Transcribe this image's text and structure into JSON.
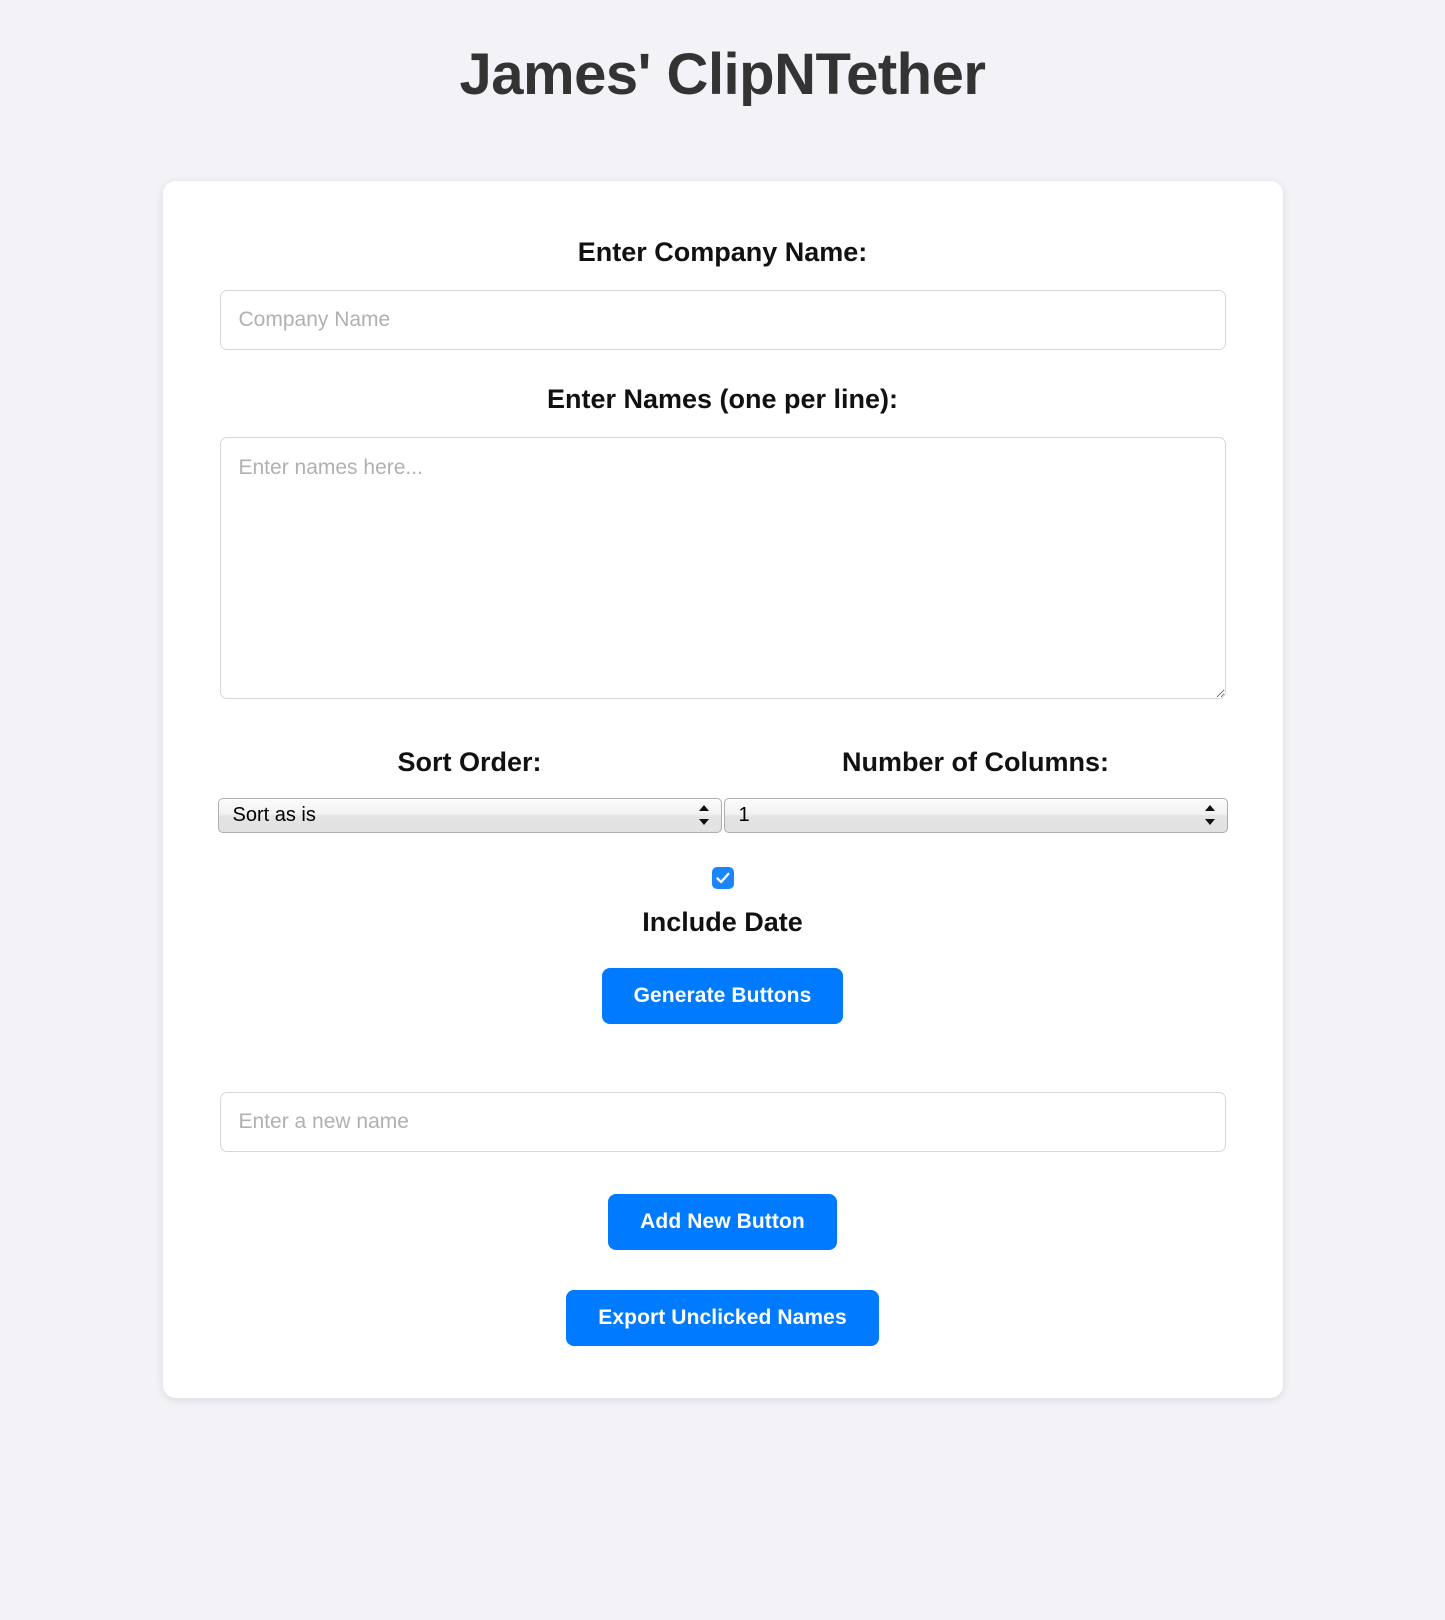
{
  "app": {
    "title": "James' ClipNTether",
    "accent_color": "#007bff",
    "background_color": "#f2f2f7",
    "card_color": "#ffffff"
  },
  "form": {
    "company": {
      "label": "Enter Company Name:",
      "placeholder": "Company Name",
      "value": ""
    },
    "names": {
      "label": "Enter Names (one per line):",
      "placeholder": "Enter names here...",
      "value": ""
    },
    "sort_order": {
      "label": "Sort Order:",
      "selected": "Sort as is",
      "options": [
        "Sort as is"
      ]
    },
    "columns": {
      "label": "Number of Columns:",
      "selected": "1",
      "options": [
        "1"
      ]
    },
    "include_date": {
      "label": "Include Date",
      "checked": true,
      "icon": "checkmark-icon"
    },
    "new_name": {
      "placeholder": "Enter a new name",
      "value": ""
    }
  },
  "actions": {
    "generate": "Generate Buttons",
    "add_new": "Add New Button",
    "export": "Export Unclicked Names"
  }
}
